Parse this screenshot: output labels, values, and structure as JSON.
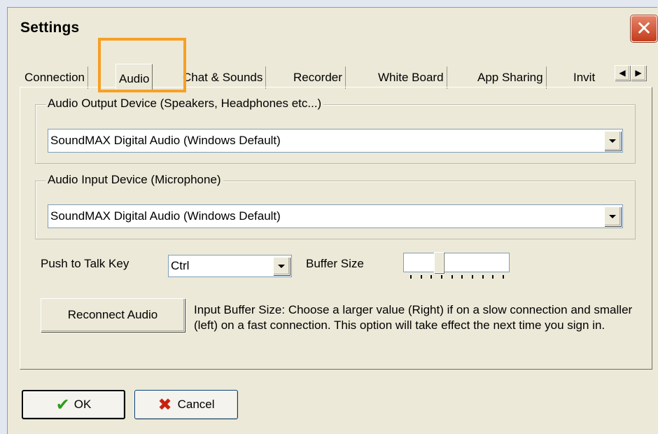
{
  "window": {
    "title": "Settings",
    "close_glyph": "✕"
  },
  "tabs": [
    {
      "label": "Connection"
    },
    {
      "label": "Audio"
    },
    {
      "label": "Chat & Sounds"
    },
    {
      "label": "Recorder"
    },
    {
      "label": "White Board"
    },
    {
      "label": "App Sharing"
    },
    {
      "label": "Invit"
    }
  ],
  "active_tab": "Audio",
  "output_device": {
    "legend": "Audio Output Device (Speakers, Headphones etc...)",
    "value": "SoundMAX Digital Audio (Windows Default)"
  },
  "input_device": {
    "legend": "Audio Input Device (Microphone)",
    "value": "SoundMAX Digital Audio (Windows Default)"
  },
  "push_to_talk": {
    "label": "Push to Talk Key",
    "value": "Ctrl"
  },
  "buffer_size": {
    "label": "Buffer Size",
    "tick_count": 10,
    "value_fraction": 0.3
  },
  "reconnect_label": "Reconnect Audio",
  "info_text": "Input Buffer Size: Choose a larger value (Right) if on a slow connection and smaller (left) on a fast connection. This option will take effect the next time you sign in.",
  "footer": {
    "ok_label": "OK",
    "cancel_label": "Cancel"
  },
  "icons": {
    "ok": "checkmark-icon",
    "cancel": "x-icon",
    "close": "close-icon"
  },
  "colors": {
    "highlight": "#f7a024",
    "close_button": "#c43c1d"
  }
}
